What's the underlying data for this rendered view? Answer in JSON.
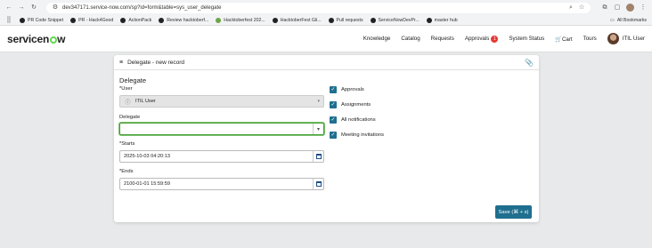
{
  "browser": {
    "url": "dev347171.service-now.com/sp?id=form&table=sys_user_delegate",
    "all_bookmarks": "All Bookmarks"
  },
  "bookmarks": [
    "PR Code Snippet",
    "PR - Hack4Good",
    "ActionPack",
    "Review hacktoberf...",
    "Hacktoberfest 202...",
    "HacktoberFest Gli...",
    "Pull requests",
    "ServiceNowDevPr...",
    "master hub"
  ],
  "header": {
    "logo_left": "servicen",
    "logo_right": "w",
    "nav": {
      "knowledge": "Knowledge",
      "catalog": "Catalog",
      "requests": "Requests",
      "approvals": "Approvals",
      "approvals_count": "1",
      "system_status": "System Status",
      "cart": "Cart",
      "tours": "Tours",
      "user": "ITIL User"
    }
  },
  "form": {
    "title": "Delegate - new record",
    "section": "Delegate",
    "user_label": "User",
    "user_value": "ITIL User",
    "delegate_label": "Delegate",
    "delegate_value": "",
    "starts_label": "Starts",
    "starts_value": "2025-10-03 04:20:13",
    "ends_label": "Ends",
    "ends_value": "2100-01-01 15:59:59",
    "required_mark": "*",
    "checkboxes": [
      {
        "label": "Approvals",
        "checked": true
      },
      {
        "label": "Assignments",
        "checked": true
      },
      {
        "label": "All notifications",
        "checked": true
      },
      {
        "label": "Meeting invitations",
        "checked": true
      }
    ],
    "save_label": "Save (⌘ + s)"
  },
  "colors": {
    "primary": "#1f6f8f",
    "focus_border": "#4a9e3a",
    "badge": "#e53935",
    "logo_accent": "#62d84e"
  }
}
